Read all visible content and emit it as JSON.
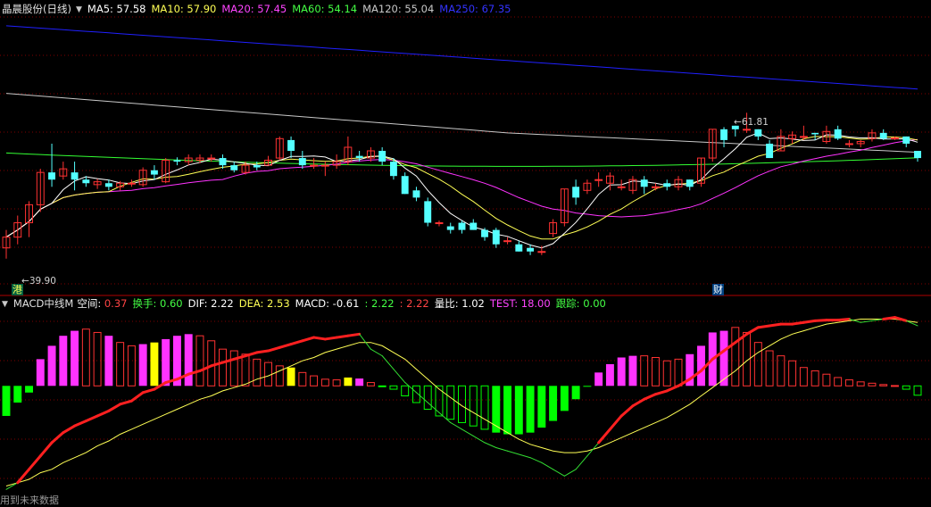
{
  "header": {
    "stock_name": "晶晨股份(日线)",
    "indicators": [
      {
        "label": "MA5: 57.58",
        "color": "#ffffff"
      },
      {
        "label": "MA10: 57.90",
        "color": "#ffff55"
      },
      {
        "label": "MA20: 57.45",
        "color": "#ff44ff"
      },
      {
        "label": "MA60: 54.14",
        "color": "#44ff44"
      },
      {
        "label": "MA120: 55.04",
        "color": "#c8c8c8"
      },
      {
        "label": "MA250: 67.35",
        "color": "#3333ff"
      }
    ]
  },
  "sub_header": {
    "indicator_name": "MACD中线M",
    "items": [
      {
        "label": "空间: ",
        "value": "0.37",
        "label_color": "#ffffff",
        "value_color": "#ff4444"
      },
      {
        "label": "换手: ",
        "value": "0.60",
        "label_color": "#44ff44",
        "value_color": "#44ff44"
      },
      {
        "label": "DIF: ",
        "value": "2.22",
        "label_color": "#ffffff",
        "value_color": "#ffffff"
      },
      {
        "label": "DEA: ",
        "value": "2.53",
        "label_color": "#ffff55",
        "value_color": "#ffff55"
      },
      {
        "label": "MACD: ",
        "value": "-0.61",
        "label_color": "#ffffff",
        "value_color": "#ffffff"
      },
      {
        "label": ": ",
        "value": "2.22",
        "label_color": "#44ff44",
        "value_color": "#44ff44"
      },
      {
        "label": ": ",
        "value": "2.22",
        "label_color": "#ff4444",
        "value_color": "#ff4444"
      },
      {
        "label": "量比: ",
        "value": "1.02",
        "label_color": "#ffffff",
        "value_color": "#ffffff"
      },
      {
        "label": "TEST: ",
        "value": "18.00",
        "label_color": "#ff44ff",
        "value_color": "#ff44ff"
      },
      {
        "label": "跟踪: ",
        "value": "0.00",
        "label_color": "#44ff44",
        "value_color": "#44ff44"
      }
    ]
  },
  "annotations": {
    "low_price": "39.90",
    "high_price": "61.81",
    "tag_gang": "港",
    "tag_cai": "财"
  },
  "footer_note": "用到未来数据",
  "colors": {
    "up": "#ff3232",
    "down": "#54ffff",
    "grid": "#800000",
    "macd_pos": "#ff33ff",
    "macd_pos_hollow": "#ff3232",
    "macd_neg": "#00ff00",
    "macd_yellow": "#ffff00"
  },
  "chart_data": [
    {
      "type": "candlestick",
      "price_range": [
        38,
        75
      ],
      "candles": [
        [
          43,
          44.5,
          41.5,
          45.5
        ],
        [
          44.5,
          46.5,
          43.5,
          47.5
        ],
        [
          46.5,
          49,
          44.5,
          49.5
        ],
        [
          49,
          53.5,
          48,
          54
        ],
        [
          53.5,
          52.5,
          51.5,
          57.5
        ],
        [
          53,
          54,
          52.5,
          55
        ],
        [
          53.5,
          52.5,
          51,
          55
        ],
        [
          52.5,
          52,
          51.5,
          53
        ],
        [
          51.8,
          52.2,
          51.2,
          52.6
        ],
        [
          52,
          51.5,
          51,
          52.5
        ],
        [
          51.5,
          52,
          51,
          52.3
        ],
        [
          52,
          52,
          51.5,
          52.5
        ],
        [
          51.8,
          53.8,
          51.5,
          54.2
        ],
        [
          53.8,
          53.2,
          52.5,
          54.5
        ],
        [
          52.2,
          55.2,
          52,
          55.5
        ],
        [
          55.2,
          55,
          54.5,
          55.6
        ],
        [
          55,
          55.5,
          54.5,
          56
        ],
        [
          55.2,
          55.5,
          54.8,
          56
        ],
        [
          55.5,
          55.5,
          55,
          56
        ],
        [
          55.5,
          54.5,
          54,
          56
        ],
        [
          54.5,
          53.8,
          53.5,
          55
        ],
        [
          53.5,
          54.5,
          53.2,
          55
        ],
        [
          54.5,
          54.2,
          53.8,
          55
        ],
        [
          54.5,
          55.2,
          54.5,
          55.8
        ],
        [
          55.5,
          58.2,
          55.2,
          58.5
        ],
        [
          58,
          56.5,
          55.5,
          58.5
        ],
        [
          55.5,
          54.5,
          54,
          56.5
        ],
        [
          54.5,
          54.5,
          54,
          55.5
        ],
        [
          54.5,
          54.5,
          53,
          55
        ],
        [
          54.5,
          55,
          54,
          56
        ],
        [
          55,
          57,
          54.5,
          58.5
        ],
        [
          55.8,
          55.5,
          55,
          56.5
        ],
        [
          55.5,
          56.5,
          55,
          57
        ],
        [
          56.5,
          55,
          54.5,
          57
        ],
        [
          55,
          53,
          52.5,
          55.5
        ],
        [
          53,
          50.5,
          50.5,
          53.5
        ],
        [
          51,
          50,
          49.5,
          51.5
        ],
        [
          49.5,
          46.5,
          46,
          50
        ],
        [
          46.5,
          46.5,
          46,
          46.8
        ],
        [
          46,
          45.5,
          45,
          46.5
        ],
        [
          46.5,
          45.5,
          45,
          46.8
        ],
        [
          46.5,
          45.5,
          45.5,
          47
        ],
        [
          45.5,
          44.5,
          44,
          45.8
        ],
        [
          45.5,
          43.5,
          43,
          45.8
        ],
        [
          44,
          44,
          43.5,
          44.5
        ],
        [
          43.5,
          42.5,
          42.5,
          44
        ],
        [
          43,
          42.5,
          42,
          43.5
        ],
        [
          42.5,
          42.5,
          42,
          43.3
        ],
        [
          45,
          46.5,
          44.5,
          47
        ],
        [
          46.5,
          51.2,
          46,
          51.2
        ],
        [
          51.5,
          50,
          49,
          52.5
        ],
        [
          51,
          52,
          50.5,
          52.5
        ],
        [
          52.5,
          52.5,
          51.5,
          53.5
        ],
        [
          52,
          53,
          51,
          53.5
        ],
        [
          51.5,
          51.5,
          51,
          52.5
        ],
        [
          51,
          52.5,
          50.5,
          53
        ],
        [
          52.5,
          51.5,
          50.5,
          53
        ],
        [
          51.5,
          51.5,
          51,
          52
        ],
        [
          52,
          51.5,
          51,
          52.5
        ],
        [
          51.5,
          52.5,
          51,
          53
        ],
        [
          52.5,
          51.5,
          51,
          52.5
        ],
        [
          52,
          55.5,
          51.5,
          55.5
        ],
        [
          55.5,
          59.5,
          55,
          59.5
        ],
        [
          59.5,
          58,
          57,
          59.8
        ],
        [
          60,
          59.5,
          58.5,
          60
        ],
        [
          59.5,
          59.5,
          59,
          61.8
        ],
        [
          59.5,
          58.5,
          58,
          59.5
        ],
        [
          57.5,
          55.5,
          55.5,
          58
        ],
        [
          56.5,
          58.5,
          56.5,
          59.5
        ],
        [
          58.2,
          58.7,
          57.5,
          59.2
        ],
        [
          58.5,
          58.5,
          58,
          60
        ],
        [
          59,
          58.8,
          58,
          59
        ],
        [
          57.8,
          59.2,
          57.5,
          60
        ],
        [
          59.5,
          58.2,
          58,
          60
        ],
        [
          57.5,
          57.5,
          57,
          58
        ],
        [
          57.5,
          57.8,
          57,
          58
        ],
        [
          58.2,
          59,
          57.8,
          59.5
        ],
        [
          59,
          58.2,
          58,
          59.5
        ],
        [
          58.3,
          58.3,
          58,
          58.5
        ],
        [
          58.5,
          57.5,
          57,
          58.5
        ],
        [
          56.5,
          55.5,
          55,
          56.5
        ]
      ]
    },
    {
      "type": "bar",
      "name": "MACD",
      "range": [
        -3.2,
        2.2
      ],
      "values": [
        -0.9,
        -0.5,
        -0.2,
        0.8,
        1.2,
        1.5,
        1.65,
        1.7,
        1.6,
        1.5,
        1.3,
        1.2,
        1.25,
        1.3,
        1.4,
        1.5,
        1.55,
        1.5,
        1.35,
        1.1,
        1.05,
        0.95,
        0.8,
        0.7,
        0.6,
        0.55,
        0.4,
        0.3,
        0.2,
        0.18,
        0.25,
        0.22,
        0.1,
        -0.02,
        -0.1,
        -0.3,
        -0.5,
        -0.7,
        -0.9,
        -1.0,
        -1.1,
        -1.2,
        -1.3,
        -1.4,
        -1.45,
        -1.45,
        -1.4,
        -1.25,
        -1.05,
        -0.75,
        -0.4,
        -0.02,
        0.4,
        0.65,
        0.85,
        0.9,
        0.9,
        0.85,
        0.75,
        0.8,
        0.95,
        1.2,
        1.6,
        1.65,
        1.75,
        1.6,
        1.3,
        1.05,
        0.9,
        0.75,
        0.55,
        0.45,
        0.35,
        0.25,
        0.18,
        0.12,
        0.08,
        0.04,
        0.01,
        -0.1,
        -0.28
      ],
      "yellow_idx": [
        13,
        25,
        30
      ],
      "filled_pos_idx": [
        3,
        4,
        5,
        6,
        9,
        12,
        14,
        15,
        16,
        31,
        52,
        53,
        54,
        55,
        60,
        61,
        62,
        63
      ],
      "filled_neg_idx": [
        0,
        1,
        2,
        43,
        44,
        45,
        46,
        47,
        48,
        49,
        50,
        51
      ]
    },
    {
      "type": "line",
      "name": "DIF",
      "values": [
        -3.1,
        -2.9,
        -2.5,
        -2.1,
        -1.7,
        -1.4,
        -1.2,
        -1.05,
        -0.9,
        -0.75,
        -0.55,
        -0.45,
        -0.2,
        -0.1,
        0.1,
        0.2,
        0.35,
        0.45,
        0.6,
        0.7,
        0.8,
        0.9,
        1.0,
        1.05,
        1.15,
        1.25,
        1.35,
        1.45,
        1.4,
        1.45,
        1.5,
        1.55,
        1.1,
        0.9,
        0.5,
        0.1,
        -0.2,
        -0.5,
        -0.8,
        -1.1,
        -1.3,
        -1.5,
        -1.7,
        -1.85,
        -1.95,
        -2.05,
        -2.15,
        -2.3,
        -2.5,
        -2.7,
        -2.5,
        -2.1,
        -1.7,
        -1.3,
        -0.9,
        -0.6,
        -0.4,
        -0.25,
        -0.15,
        0.0,
        0.2,
        0.45,
        0.8,
        1.05,
        1.3,
        1.55,
        1.75,
        1.8,
        1.85,
        1.85,
        1.9,
        1.95,
        1.97,
        1.97,
        2.0,
        1.9,
        1.95,
        2.0,
        2.05,
        1.95,
        1.8
      ]
    },
    {
      "type": "line",
      "name": "DEA",
      "values": [
        -3.0,
        -2.9,
        -2.8,
        -2.6,
        -2.5,
        -2.3,
        -2.15,
        -2.0,
        -1.8,
        -1.65,
        -1.45,
        -1.3,
        -1.15,
        -1.0,
        -0.85,
        -0.7,
        -0.55,
        -0.4,
        -0.3,
        -0.15,
        -0.05,
        0.05,
        0.2,
        0.3,
        0.45,
        0.6,
        0.75,
        0.85,
        1.0,
        1.1,
        1.2,
        1.3,
        1.3,
        1.2,
        1.0,
        0.8,
        0.5,
        0.2,
        -0.1,
        -0.35,
        -0.6,
        -0.8,
        -1.0,
        -1.2,
        -1.4,
        -1.6,
        -1.75,
        -1.85,
        -1.95,
        -2.0,
        -2.0,
        -1.95,
        -1.85,
        -1.7,
        -1.55,
        -1.4,
        -1.25,
        -1.1,
        -0.95,
        -0.75,
        -0.55,
        -0.3,
        -0.05,
        0.2,
        0.45,
        0.75,
        1.0,
        1.2,
        1.4,
        1.55,
        1.65,
        1.75,
        1.85,
        1.9,
        1.95,
        2.0,
        2.0,
        2.0,
        2.0,
        1.95,
        1.9
      ]
    }
  ]
}
